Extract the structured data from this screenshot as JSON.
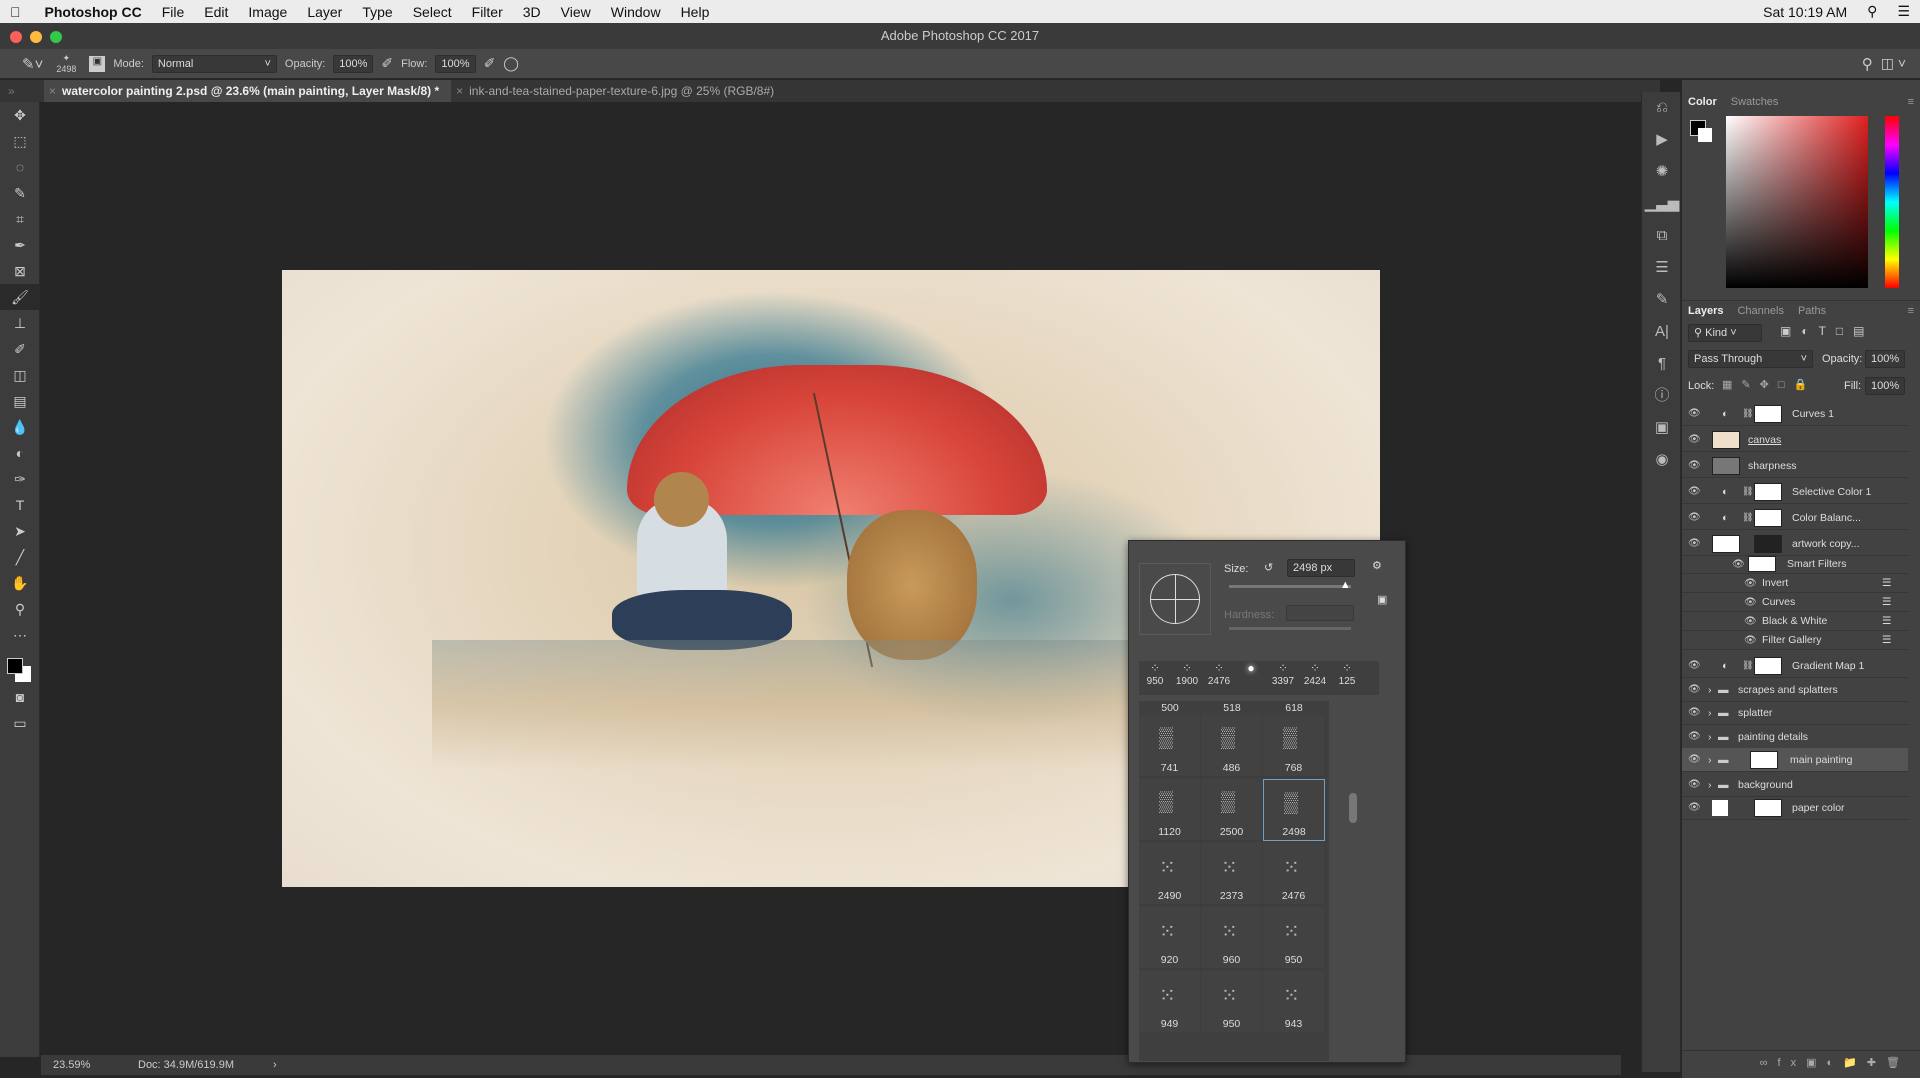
{
  "menubar": {
    "app": "Photoshop CC",
    "items": [
      "File",
      "Edit",
      "Image",
      "Layer",
      "Type",
      "Select",
      "Filter",
      "3D",
      "View",
      "Window",
      "Help"
    ],
    "clock": "Sat 10:19 AM"
  },
  "titlebar": {
    "title": "Adobe Photoshop CC 2017"
  },
  "options": {
    "brush_size": "2498",
    "mode_label": "Mode:",
    "mode_value": "Normal",
    "opacity_label": "Opacity:",
    "opacity_value": "100%",
    "flow_label": "Flow:",
    "flow_value": "100%"
  },
  "tabs": [
    {
      "label": "watercolor painting 2.psd @ 23.6% (main painting, Layer Mask/8) *",
      "active": true
    },
    {
      "label": "ink-and-tea-stained-paper-texture-6.jpg @ 25% (RGB/8#)",
      "active": false
    }
  ],
  "tools": [
    "move",
    "marquee",
    "lasso",
    "quick-select",
    "crop",
    "eyedropper",
    "frame",
    "brush",
    "stamp",
    "history-brush",
    "eraser",
    "gradient",
    "blur",
    "dodge",
    "pen",
    "type",
    "path-select",
    "line",
    "hand",
    "zoom",
    "more"
  ],
  "status": {
    "zoom": "23.59%",
    "doc": "Doc: 34.9M/619.9M"
  },
  "color_panel": {
    "tabs": [
      "Color",
      "Swatches"
    ],
    "accent": "#e02020"
  },
  "layers_panel": {
    "tabs": [
      "Layers",
      "Channels",
      "Paths"
    ],
    "kind": "Kind",
    "blend": "Pass Through",
    "opacity_label": "Opacity:",
    "opacity": "100%",
    "lock_label": "Lock:",
    "fill_label": "Fill:",
    "fill": "100%",
    "layers": [
      {
        "name": "Curves 1",
        "type": "adjustment"
      },
      {
        "name": "canvas",
        "type": "pixel"
      },
      {
        "name": "sharpness",
        "type": "pixel"
      },
      {
        "name": "Selective Color 1",
        "type": "adjustment"
      },
      {
        "name": "Color Balanc...",
        "type": "adjustment"
      },
      {
        "name": "artwork copy...",
        "type": "smart"
      },
      {
        "name": "Smart Filters",
        "type": "smartfilters"
      },
      {
        "name": "Invert",
        "type": "filter"
      },
      {
        "name": "Curves",
        "type": "filter"
      },
      {
        "name": "Black & White",
        "type": "filter"
      },
      {
        "name": "Filter Gallery",
        "type": "filter"
      },
      {
        "name": "Gradient Map 1",
        "type": "adjustment"
      },
      {
        "name": "scrapes and splatters",
        "type": "group"
      },
      {
        "name": "splatter",
        "type": "group"
      },
      {
        "name": "painting details",
        "type": "group"
      },
      {
        "name": "main painting",
        "type": "group-mask",
        "selected": true
      },
      {
        "name": "background",
        "type": "group"
      },
      {
        "name": "paper color",
        "type": "fill"
      }
    ]
  },
  "brush_picker": {
    "size_label": "Size:",
    "size_value": "2498 px",
    "hardness_label": "Hardness:",
    "size_fraction": 0.95,
    "recent": [
      "950",
      "1900",
      "2476",
      "",
      "3397",
      "2424",
      "125"
    ],
    "header_row": [
      "500",
      "518",
      "618"
    ],
    "grid": [
      "741",
      "486",
      "768",
      "1120",
      "2500",
      "2498",
      "2490",
      "2373",
      "2476",
      "920",
      "960",
      "950",
      "949",
      "950",
      "943"
    ],
    "selected": "2498"
  }
}
